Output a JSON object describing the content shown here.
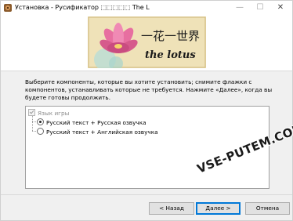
{
  "window": {
    "title": "Установка - Русификатор ⬚⬚⬚⬚⬚  The L",
    "minimize_glyph": "—",
    "maximize_glyph": "☐",
    "close_glyph": "✕"
  },
  "banner": {
    "chinese_text": "一花一世界",
    "english_text": "the lotus"
  },
  "main": {
    "instructions": "Выберите компоненты, которые вы хотите установить; снимите флажки с компонентов, устанавливать которые не требуется. Нажмите «Далее», когда вы будете готовы продолжить.",
    "components": {
      "group_label": "Язык игры",
      "group_checked": true,
      "options": [
        {
          "label": "Русский текст + Русская озвучка",
          "selected": true
        },
        {
          "label": "Русский текст + Английская озвучка",
          "selected": false
        }
      ]
    }
  },
  "watermark": "VSE-PUTEM.COM",
  "footer": {
    "back_label": "< Назад",
    "next_label": "Далее >",
    "cancel_label": "Отмена"
  },
  "icons": {
    "app": "installer-icon",
    "group_checkbox": "checkbox-checked-disabled-icon",
    "radio_selected": "radio-selected-icon",
    "radio_unselected": "radio-unselected-icon"
  }
}
